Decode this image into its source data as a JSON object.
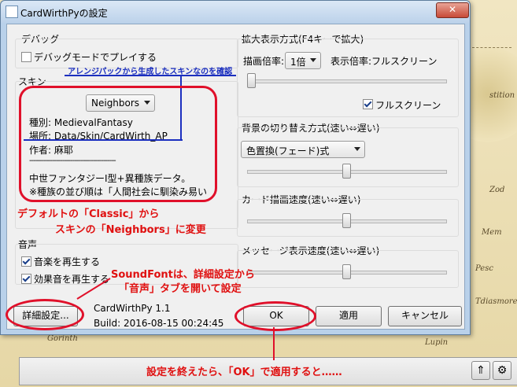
{
  "window": {
    "title": "CardWirthPyの設定",
    "close": "✕"
  },
  "debug": {
    "group": "デバッグ",
    "checkbox": "デバッグモードでプレイする",
    "checked": false
  },
  "skin": {
    "group": "スキン",
    "selected": "Neighbors",
    "kind": "種別: MedievalFantasy",
    "location": "場所: Data/Skin/CardWirth_AP",
    "author": "作者: 麻耶",
    "separator": "------------------------------------------",
    "desc1": "中世ファンタジーⅠ型+異種族データ。",
    "desc2": "※種族の並び順は「人間社会に馴染み易い"
  },
  "sound": {
    "group": "音声",
    "music": "音楽を再生する",
    "effects": "効果音を再生する",
    "music_checked": true,
    "effects_checked": true
  },
  "zoom": {
    "group": "拡大表示方式(F4キーで拡大)",
    "rate_label": "描画倍率:",
    "rate_value": "1倍",
    "display_rate": "表示倍率:フルスクリーン",
    "fullscreen": "フルスクリーン",
    "fullscreen_checked": true,
    "slider_level": 0.0
  },
  "bg": {
    "group": "背景の切り替え方式(速い⇔遅い)",
    "method": "色置換(フェード)式",
    "slider_level": 0.5
  },
  "card": {
    "group": "カード描画速度(速い⇔遅い)",
    "slider_level": 0.5
  },
  "message": {
    "group": "メッセージ表示速度(速い⇔遅い)",
    "slider_level": 0.5
  },
  "footer": {
    "details": "詳細設定...",
    "app": "CardWirthPy 1.1",
    "build": "Build: 2016-08-15 00:24:45",
    "ok": "OK",
    "apply": "適用",
    "cancel": "キャンセル"
  },
  "annotations": {
    "arrange": "アレンジパックから生成したスキンなのを確認",
    "skin_change1": "デフォルトの「Classic」から",
    "skin_change2": "スキンの「Neighbors」に変更",
    "soundfont1": "SoundFontは、詳細設定から",
    "soundfont2": "「音声」タブを開いて設定",
    "apply_note": "設定を終えたら、「OK」で適用すると……"
  },
  "map": {
    "labels": [
      "stition",
      "Zod",
      "Mem",
      "Pesc",
      "Tdiasmore",
      "Gorinth",
      "Lupin"
    ]
  },
  "colors": {
    "annotation_red": "#e01010",
    "annotation_blue": "#1b2fbf"
  }
}
